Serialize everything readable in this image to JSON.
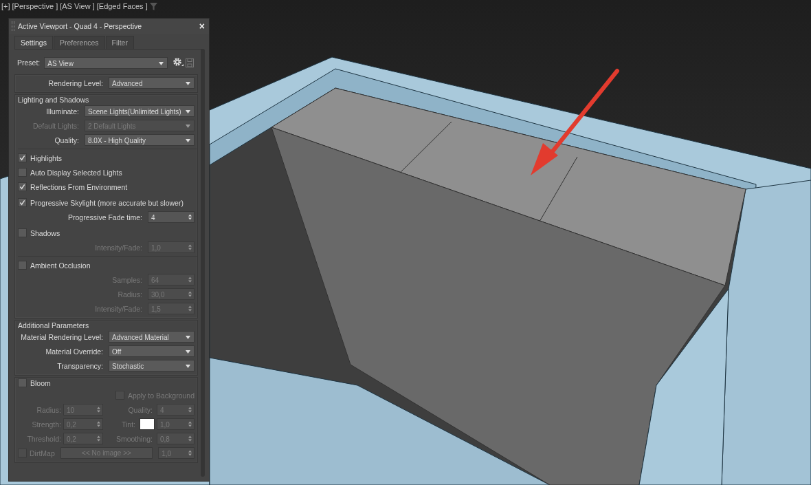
{
  "viewport_label": [
    "[+]",
    "[Perspective ]",
    "[AS View ]",
    "[Edged Faces ]"
  ],
  "panel": {
    "title": "Active Viewport - Quad 4 - Perspective",
    "close": "×",
    "tabs": [
      {
        "label": "Settings",
        "selected": true
      },
      {
        "label": "Preferences",
        "selected": false
      },
      {
        "label": "Filter",
        "selected": false
      }
    ],
    "preset": {
      "label": "Preset:",
      "value": "AS View"
    },
    "sections": [
      {
        "groups": [
          {
            "divider": false,
            "rows": [
              {
                "kind": "dropdown",
                "label": "Rendering Level:",
                "value": "Advanced",
                "disabled": false
              }
            ]
          }
        ]
      },
      {
        "title": "Lighting and Shadows",
        "groups": [
          {
            "divider": false,
            "rows": [
              {
                "kind": "dropdown",
                "label": "Illuminate:",
                "value": "Scene Lights(Unlimited Lights)",
                "disabled": false
              },
              {
                "kind": "dropdown",
                "label": "Default Lights:",
                "value": "2 Default Lights",
                "disabled": true
              },
              {
                "kind": "dropdown",
                "label": "Quality:",
                "value": "8.0X - High Quality",
                "disabled": false
              }
            ]
          },
          {
            "divider": true,
            "rows": [
              {
                "kind": "checkbox",
                "label": "Highlights",
                "checked": true,
                "disabled": false
              },
              {
                "kind": "checkbox",
                "label": "Auto Display Selected Lights",
                "checked": false,
                "disabled": false
              },
              {
                "kind": "checkbox",
                "label": "Reflections From Environment",
                "checked": true,
                "disabled": false
              }
            ]
          },
          {
            "divider": false,
            "rows": [
              {
                "kind": "checkbox",
                "label": "Progressive Skylight (more accurate but slower)",
                "checked": true,
                "disabled": false
              },
              {
                "kind": "spinner",
                "label": "Progressive Fade time:",
                "value": "4",
                "disabled": false
              }
            ]
          },
          {
            "divider": false,
            "rows": [
              {
                "kind": "checkbox",
                "label": "Shadows",
                "checked": false,
                "disabled": false
              },
              {
                "kind": "spinner",
                "label": "Intensity/Fade:",
                "value": "1,0",
                "disabled": true
              }
            ]
          },
          {
            "divider": true,
            "rows": [
              {
                "kind": "checkbox",
                "label": "Ambient Occlusion",
                "checked": false,
                "disabled": false
              },
              {
                "kind": "spinner",
                "label": "Samples:",
                "value": "64",
                "disabled": true
              },
              {
                "kind": "spinner",
                "label": "Radius:",
                "value": "30,0",
                "disabled": true
              },
              {
                "kind": "spinner",
                "label": "Intensity/Fade:",
                "value": "1,5",
                "disabled": true
              }
            ]
          }
        ]
      },
      {
        "title": "Additional Parameters",
        "groups": [
          {
            "divider": false,
            "rows": [
              {
                "kind": "dropdown",
                "label": "Material Rendering Level:",
                "value": "Advanced Material",
                "disabled": false
              },
              {
                "kind": "dropdown",
                "label": "Material Override:",
                "value": "Off",
                "disabled": false
              },
              {
                "kind": "dropdown",
                "label": "Transparency:",
                "value": "Stochastic",
                "disabled": false
              }
            ]
          }
        ]
      },
      {
        "header_checkbox": {
          "label": "Bloom",
          "checked": false
        },
        "groups": [
          {
            "divider": false,
            "rows": [
              {
                "kind": "checkbox_right",
                "label": "Apply to Background",
                "checked": false,
                "disabled": true
              },
              {
                "kind": "pair",
                "left": {
                  "label": "Radius:",
                  "value": "10",
                  "disabled": true
                },
                "right": {
                  "label": "Quality:",
                  "value": "4",
                  "disabled": true
                }
              },
              {
                "kind": "pair",
                "left": {
                  "label": "Strength:",
                  "value": "0,2",
                  "disabled": true
                },
                "right": {
                  "label": "Tint:",
                  "value": "1,0",
                  "disabled": true,
                  "color": "#ffffff"
                }
              },
              {
                "kind": "pair",
                "left": {
                  "label": "Threshold:",
                  "value": "0,2",
                  "disabled": true
                },
                "right": {
                  "label": "Smoothing:",
                  "value": "0,8",
                  "disabled": true
                }
              },
              {
                "kind": "dirtmap",
                "label": "DirtMap",
                "checked": false,
                "disabled": true,
                "button": "<< No image >>",
                "value": "1,0"
              }
            ]
          }
        ]
      }
    ]
  }
}
